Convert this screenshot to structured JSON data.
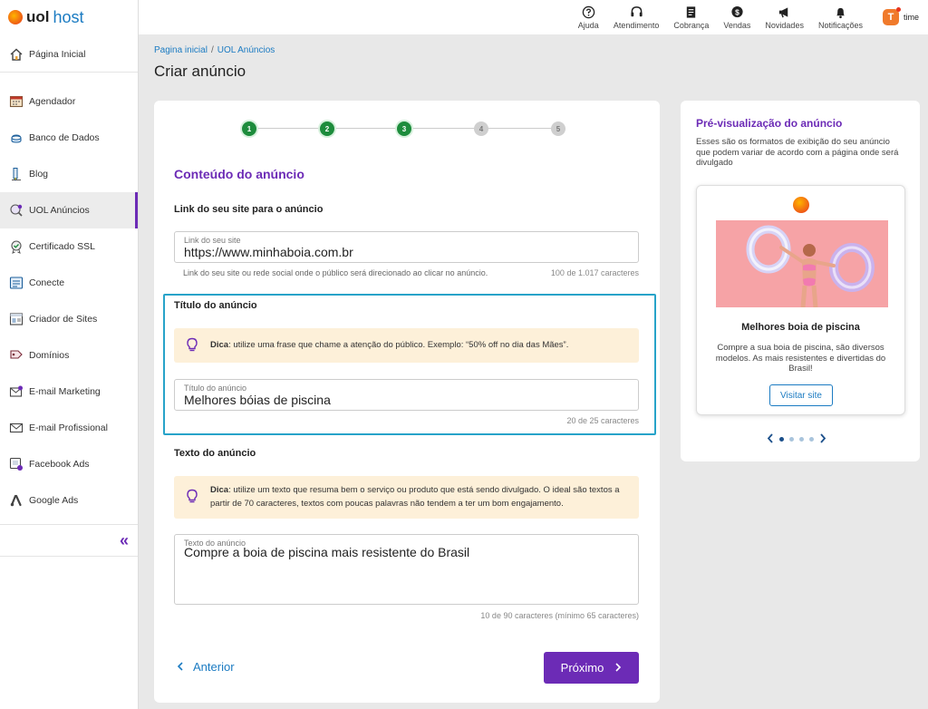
{
  "brand": {
    "uol": "uol",
    "host": "host"
  },
  "sidebar": {
    "items": [
      {
        "label": "Página Inicial",
        "icon": "home-icon"
      },
      {
        "label": "Agendador",
        "icon": "calendar-icon"
      },
      {
        "label": "Banco de Dados",
        "icon": "database-icon"
      },
      {
        "label": "Blog",
        "icon": "blog-icon"
      },
      {
        "label": "UOL Anúncios",
        "icon": "ads-icon",
        "active": true
      },
      {
        "label": "Certificado SSL",
        "icon": "certificate-icon"
      },
      {
        "label": "Conecte",
        "icon": "connect-icon"
      },
      {
        "label": "Criador de Sites",
        "icon": "site-builder-icon"
      },
      {
        "label": "Domínios",
        "icon": "domain-icon"
      },
      {
        "label": "E-mail Marketing",
        "icon": "email-marketing-icon"
      },
      {
        "label": "E-mail Profissional",
        "icon": "email-icon"
      },
      {
        "label": "Facebook Ads",
        "icon": "facebook-ads-icon"
      },
      {
        "label": "Google Ads",
        "icon": "google-ads-icon"
      }
    ],
    "collapse": "«"
  },
  "topbar": {
    "items": [
      {
        "label": "Ajuda",
        "icon": "help-icon"
      },
      {
        "label": "Atendimento",
        "icon": "headset-icon"
      },
      {
        "label": "Cobrança",
        "icon": "invoice-icon"
      },
      {
        "label": "Vendas",
        "icon": "sales-icon"
      },
      {
        "label": "Novidades",
        "icon": "megaphone-icon"
      },
      {
        "label": "Notificações",
        "icon": "bell-icon"
      }
    ],
    "user": {
      "initial": "T",
      "name": "time"
    }
  },
  "breadcrumb": {
    "home": "Pagina inicial",
    "separator": "/",
    "current": "UOL Anúncios"
  },
  "page_title": "Criar anúncio",
  "stepper": {
    "steps": [
      "1",
      "2",
      "3",
      "4",
      "5"
    ],
    "completed": 3
  },
  "form": {
    "section_title": "Conteúdo do anúncio",
    "link": {
      "label": "Link do seu site para o anúncio",
      "field_label": "Link do seu site",
      "value": "https://www.minhaboia.com.br",
      "helper": "Link do seu site ou rede social onde o público será direcionado ao clicar no anúncio.",
      "counter": "100 de 1.017 caracteres"
    },
    "title": {
      "label": "Título do anúncio",
      "tip_bold": "Dica",
      "tip_text": ": utilize uma frase que chame a atenção do público. Exemplo: “50% off no dia das Mães”.",
      "field_label": "Título do anúncio",
      "value": "Melhores bóias de piscina",
      "counter": "20 de 25 caracteres"
    },
    "text": {
      "label": "Texto do anúncio",
      "tip_bold": "Dica",
      "tip_text": ": utilize um texto que resuma bem o serviço ou produto que está sendo divulgado. O ideal são textos a partir de 70 caracteres, textos com poucas palavras não tendem a ter um bom engajamento.",
      "field_label": "Texto do anúncio",
      "value": "Compre a boia de piscina mais resistente do Brasil",
      "counter": "10 de 90 caracteres (mínimo 65 caracteres)"
    },
    "prev_label": "Anterior",
    "next_label": "Próximo"
  },
  "preview": {
    "title": "Pré-visualização do anúncio",
    "subtitle": "Esses são os formatos de exibição do seu anúncio que podem variar de acordo com a página onde será divulgado",
    "ad": {
      "headline": "Melhores boia de piscina",
      "description": "Compre a sua boia de piscina, são diversos modelos. As mais resistentes e divertidas do Brasil!",
      "button": "Visitar site"
    },
    "carousel": {
      "total": 5,
      "active": 1
    }
  },
  "colors": {
    "accent": "#6c2bb6",
    "link": "#1b7bc2",
    "success": "#1d8c3c",
    "highlight": "#27a3c9",
    "tip_bg": "#fdf0d9"
  }
}
